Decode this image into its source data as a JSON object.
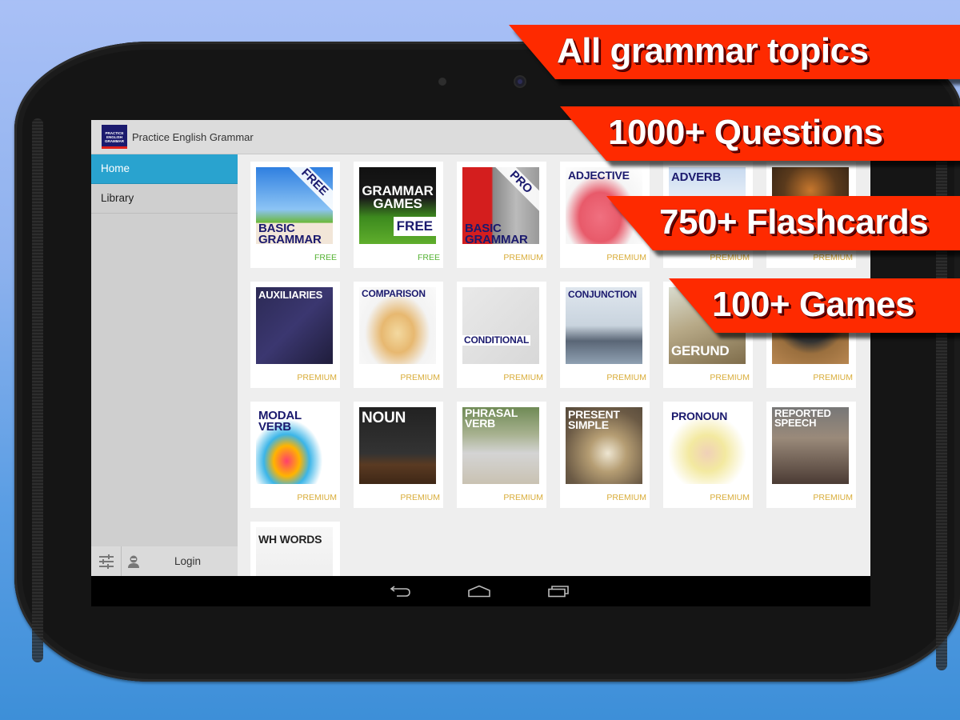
{
  "app": {
    "title": "Practice English Grammar",
    "logo_lines": [
      "PRACTICE",
      "ENGLISH",
      "GRAMMAR"
    ]
  },
  "sidebar": {
    "items": [
      {
        "label": "Home",
        "active": true
      },
      {
        "label": "Library",
        "active": false
      }
    ],
    "footer": {
      "settings_icon": "sliders-icon",
      "user_icon": "user-icon",
      "login_label": "Login"
    }
  },
  "grid": {
    "cards": [
      {
        "title": "BASIC GRAMMAR",
        "corner": "FREE",
        "tier": "FREE"
      },
      {
        "title": "GRAMMAR GAMES",
        "corner": "FREE",
        "tier": "FREE"
      },
      {
        "title": "BASIC GRAMMAR",
        "corner": "PRO",
        "tier": "PREMIUM"
      },
      {
        "title": "ADJECTIVE",
        "tier": "PREMIUM"
      },
      {
        "title": "ADVERB",
        "tier": "PREMIUM"
      },
      {
        "title": "",
        "tier": "PREMIUM"
      },
      {
        "title": "AUXILIARIES",
        "tier": "PREMIUM"
      },
      {
        "title": "COMPARISON",
        "tier": "PREMIUM"
      },
      {
        "title": "CONDITIONAL",
        "tier": "PREMIUM"
      },
      {
        "title": "CONJUNCTION",
        "tier": "PREMIUM"
      },
      {
        "title": "GERUND",
        "tier": "PREMIUM"
      },
      {
        "title": "",
        "tier": "PREMIUM"
      },
      {
        "title": "MODAL VERB",
        "tier": "PREMIUM"
      },
      {
        "title": "NOUN",
        "tier": "PREMIUM"
      },
      {
        "title": "PHRASAL VERB",
        "tier": "PREMIUM"
      },
      {
        "title": "PRESENT SIMPLE",
        "tier": "PREMIUM"
      },
      {
        "title": "PRONOUN",
        "tier": "PREMIUM"
      },
      {
        "title": "REPORTED SPEECH",
        "tier": "PREMIUM"
      },
      {
        "title": "WH WORDS",
        "tier": ""
      }
    ]
  },
  "system_nav": {
    "back_icon": "back-icon",
    "home_icon": "home-icon",
    "recents_icon": "recents-icon"
  },
  "banners": [
    "All grammar topics",
    "1000+ Questions",
    "750+ Flashcards",
    "100+ Games"
  ],
  "colors": {
    "accent": "#29a3cf",
    "banner": "#fe2a00",
    "free": "#55b233",
    "premium": "#d9ad3a",
    "title_navy": "#1b1a6e"
  }
}
